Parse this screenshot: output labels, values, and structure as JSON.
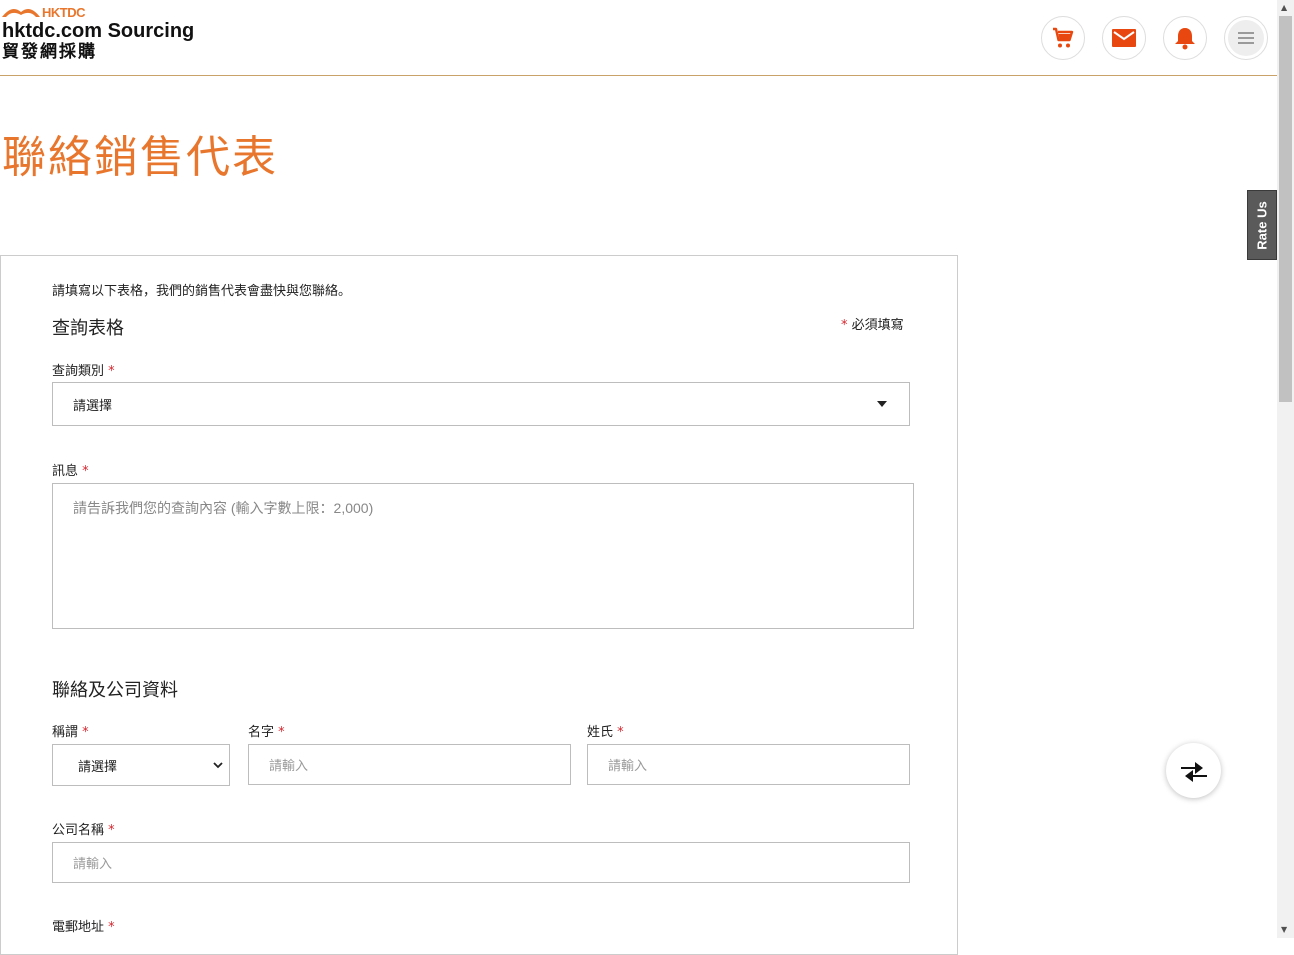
{
  "header": {
    "logo_mark": "HKTDC",
    "logo_title": "hktdc.com Sourcing",
    "logo_subtitle": "貿發網採購",
    "icons": [
      "cart-icon",
      "mail-icon",
      "bell-icon",
      "menu-icon"
    ],
    "accent_color": "#e8762c"
  },
  "rate_us": "Rate Us",
  "page_title": "聯絡銷售代表",
  "form": {
    "intro": "請填寫以下表格，我們的銷售代表會盡快與您聯絡。",
    "section1_title": "查詢表格",
    "required_note": "必須填寫",
    "required_star": "*",
    "category_label": "查詢類別",
    "category_value": "請選擇",
    "message_label": "訊息",
    "message_placeholder": "請告訴我們您的查詢內容 (輸入字數上限：2,000)",
    "section2_title": "聯絡及公司資料",
    "salutation_label": "稱謂",
    "salutation_value": "請選擇",
    "first_name_label": "名字",
    "first_name_placeholder": "請輸入",
    "last_name_label": "姓氏",
    "last_name_placeholder": "請輸入",
    "company_label": "公司名稱",
    "company_placeholder": "請輸入",
    "email_label": "電郵地址"
  },
  "fab_icon": "compare-icon"
}
